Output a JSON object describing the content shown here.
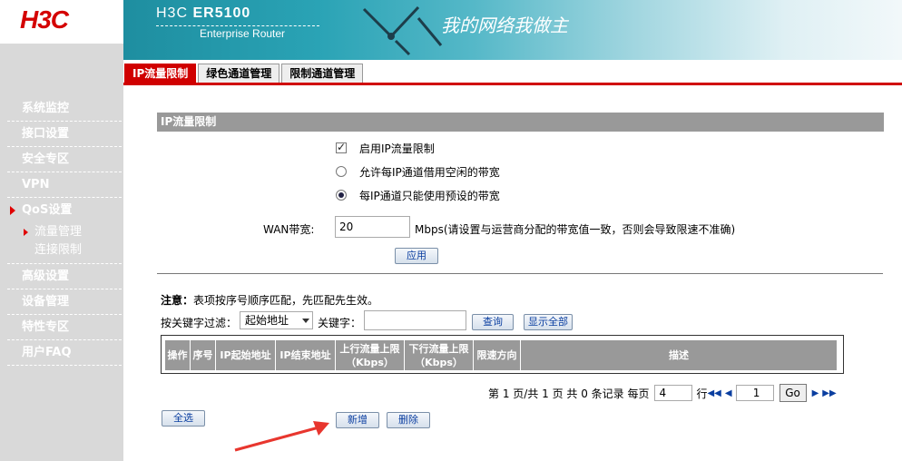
{
  "header": {
    "logo": "H3C",
    "brand": "H3C",
    "model": "ER5100",
    "subtitle": "Enterprise Router",
    "slogan": "我的网络我做主"
  },
  "sidebar": {
    "items": [
      {
        "label": "系统监控"
      },
      {
        "label": "接口设置"
      },
      {
        "label": "安全专区"
      },
      {
        "label": "VPN"
      },
      {
        "label": "QoS设置"
      },
      {
        "label": "高级设置"
      },
      {
        "label": "设备管理"
      },
      {
        "label": "特性专区"
      },
      {
        "label": "用户FAQ"
      }
    ],
    "qos_sub": [
      {
        "label": "流量管理"
      },
      {
        "label": "连接限制"
      }
    ]
  },
  "tabs": [
    {
      "label": "IP流量限制"
    },
    {
      "label": "绿色通道管理"
    },
    {
      "label": "限制通道管理"
    }
  ],
  "main": {
    "section_title": "IP流量限制",
    "enable_label": "启用IP流量限制",
    "enable_checked": true,
    "opt_borrow_label": "允许每IP通道借用空闲的带宽",
    "opt_preset_label": "每IP通道只能使用预设的带宽",
    "selected_option": "preset",
    "wan_label": "WAN带宽:",
    "wan_value": "20",
    "wan_hint": "Mbps(请设置与运营商分配的带宽值一致，否则会导致限速不准确)",
    "apply": "应用",
    "note_bold": "注意：",
    "note_text": "表项按序号顺序匹配，先匹配先生效。",
    "filter_label": "按关键字过滤：",
    "filter_value": "起始地址",
    "kw_label": "关键字：",
    "kw_value": "",
    "query": "查询",
    "show_all": "显示全部",
    "table_headers": [
      {
        "line1": "操作",
        "line2": ""
      },
      {
        "line1": "序号",
        "line2": ""
      },
      {
        "line1": "IP起始地址",
        "line2": ""
      },
      {
        "line1": "IP结束地址",
        "line2": ""
      },
      {
        "line1": "上行流量上限",
        "line2": "（Kbps）"
      },
      {
        "line1": "下行流量上限",
        "line2": "（Kbps）"
      },
      {
        "line1": "限速方向",
        "line2": ""
      },
      {
        "line1": "描述",
        "line2": ""
      }
    ],
    "pager": {
      "summary": "第 1 页/共 1 页 共 0 条记录 每页",
      "per_page": "4",
      "row_label": "行",
      "page_value": "1",
      "go": "Go"
    },
    "select_all": "全选",
    "add_new": "新增",
    "delete": "删除"
  }
}
